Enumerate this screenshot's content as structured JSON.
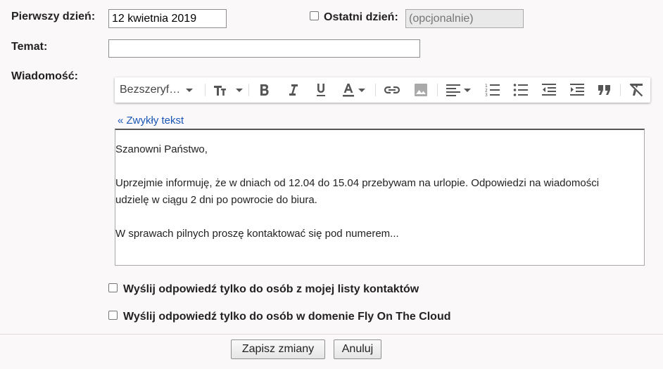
{
  "form": {
    "first_day_label": "Pierwszy dzień:",
    "first_day_value": "12 kwietnia 2019",
    "last_day_label": "Ostatni dzień:",
    "last_day_placeholder": "(opcjonalnie)",
    "subject_label": "Temat:",
    "subject_value": "",
    "message_label": "Wiadomość:"
  },
  "toolbar": {
    "font_family": "Bezszeryf…",
    "icons": [
      "text-size-icon",
      "bold-icon",
      "italic-icon",
      "underline-icon",
      "text-color-icon",
      "link-icon",
      "image-icon",
      "align-icon",
      "numbered-list-icon",
      "bulleted-list-icon",
      "indent-less-icon",
      "indent-more-icon",
      "quote-icon",
      "remove-formatting-icon"
    ]
  },
  "editor": {
    "plain_text_link": "« Zwykły tekst",
    "line1": "Szanowni Państwo,",
    "line2": "Uprzejmie informuję, że w dniach od 12.04 do 15.04 przebywam na urlopie. Odpowiedzi na wiadomości",
    "line3": "udzielę w ciągu 2 dni po powrocie do biura.",
    "line4": "W sprawach pilnych proszę kontaktować się pod numerem..."
  },
  "options": {
    "contacts_only": "Wyślij odpowiedź tylko do osób z mojej listy kontaktów",
    "domain_only": "Wyślij odpowiedź tylko do osób w domenie Fly On The Cloud"
  },
  "buttons": {
    "save": "Zapisz zmiany",
    "cancel": "Anuluj"
  },
  "colors": {
    "link": "#1a57b5",
    "background": "#fbf8f9"
  }
}
